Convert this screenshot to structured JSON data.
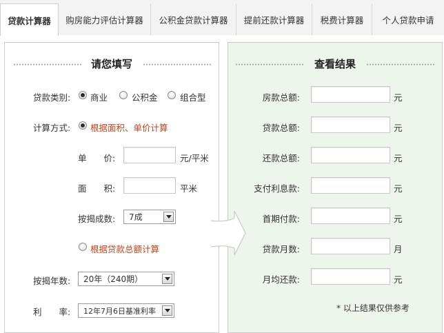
{
  "tabs": [
    {
      "label": "贷款计算器",
      "active": true
    },
    {
      "label": "购房能力评估计算器",
      "active": false
    },
    {
      "label": "公积金贷款计算器",
      "active": false
    },
    {
      "label": "提前还款计算器",
      "active": false
    },
    {
      "label": "税费计算器",
      "active": false
    },
    {
      "label": "个人贷款申请",
      "active": false
    }
  ],
  "left": {
    "title": "请您填写",
    "loan_type": {
      "label": "贷款类别:",
      "options": [
        "商业",
        "公积金",
        "组合型"
      ],
      "selected": "商业"
    },
    "calc_method": {
      "label": "计算方式:",
      "option_area": "根据面积、单价计算",
      "option_total": "根据贷款总额计算",
      "selected": "根据面积、单价计算"
    },
    "unit_price": {
      "label": "单　　价:",
      "value": "",
      "unit": "元/平米"
    },
    "area": {
      "label": "面　　积:",
      "value": "",
      "unit": "平米"
    },
    "mortgage_ratio": {
      "label": "按揭成数:",
      "value": "7成"
    },
    "mortgage_years": {
      "label": "按揭年数:",
      "value": "20年（240期）"
    },
    "rate": {
      "label": "利　　率:",
      "value": "12年7月6日基准利率"
    }
  },
  "right": {
    "title": "查看结果",
    "rows": [
      {
        "label": "房款总额:",
        "value": "",
        "unit": "元"
      },
      {
        "label": "贷款总额:",
        "value": "",
        "unit": "元"
      },
      {
        "label": "还款总额:",
        "value": "",
        "unit": "元"
      },
      {
        "label": "支付利息款:",
        "value": "",
        "unit": "元"
      },
      {
        "label": "首期付款:",
        "value": "",
        "unit": "元"
      },
      {
        "label": "贷款月数:",
        "value": "",
        "unit": "月"
      },
      {
        "label": "月均还款:",
        "value": "",
        "unit": "元"
      }
    ],
    "note": "* 以上结果仅供参考"
  },
  "colors": {
    "accent_orange": "#c8431a",
    "result_panel_bg": "#eef5ec",
    "tabbar_bg": "#f3f3f3"
  }
}
